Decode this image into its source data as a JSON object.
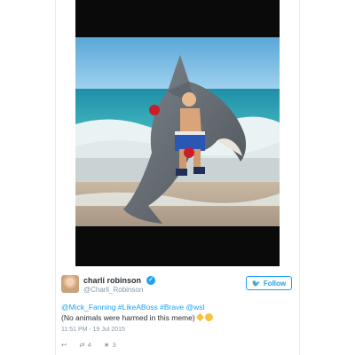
{
  "tweet": {
    "author_name": "charli robinson",
    "handle": "@Charli_Robinson",
    "follow_label": "Follow",
    "line1": "@Mick_Fanning #LikeABoss #Brave @wsl",
    "line2": "(No animals were harmed in this meme)",
    "timestamp": "11:51 PM - 19 Jul 2015",
    "retweets": "4",
    "likes": "3"
  },
  "icons": {
    "reply": "reply-icon",
    "retweet": "retweet-icon",
    "like": "star-icon",
    "follow": "twitter-bird-icon",
    "verified": "verified-badge-icon"
  },
  "colors": {
    "accent": "#1da1f2",
    "text": "#292f33",
    "muted": "#8899a6"
  }
}
